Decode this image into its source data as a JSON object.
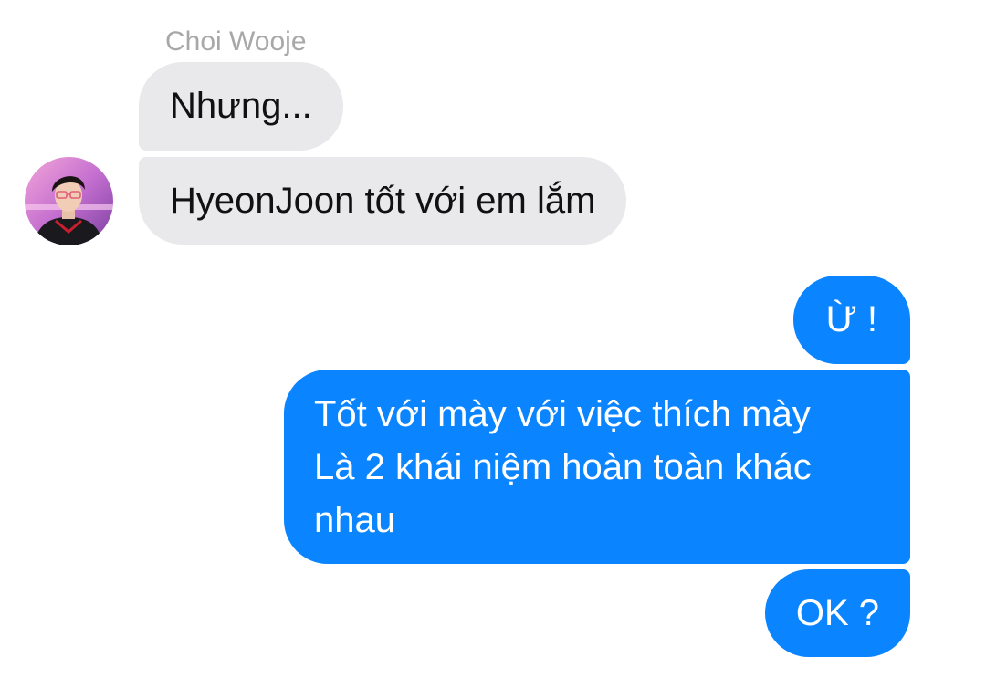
{
  "conversation": {
    "sender_name": "Choi Wooje",
    "incoming": [
      {
        "text": "Nhưng..."
      },
      {
        "text": "HyeonJoon tốt với em lắm"
      }
    ],
    "outgoing": [
      {
        "text": "Ừ !"
      },
      {
        "lines": [
          "Tốt với mày với việc thích mày",
          "Là 2 khái niệm hoàn toàn khác",
          "nhau"
        ]
      },
      {
        "text": "OK ?"
      }
    ],
    "avatar_icon": "profile-photo-icon"
  },
  "colors": {
    "incoming_bubble": "#e9e9eb",
    "outgoing_bubble": "#0a84ff",
    "sender_name": "#a8a8a8"
  }
}
